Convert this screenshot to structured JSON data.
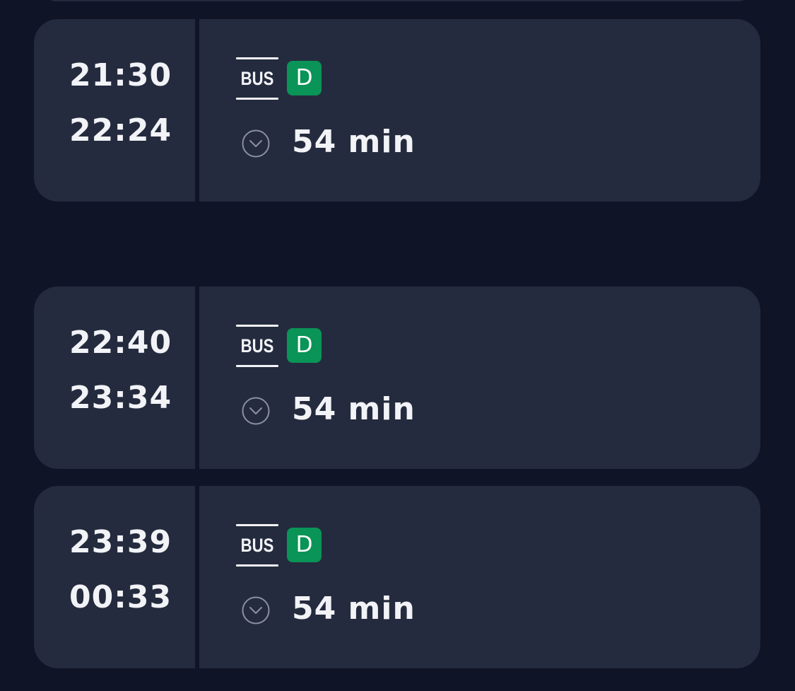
{
  "trips": [
    {
      "departure": "21:30",
      "arrival": "22:24",
      "mode": "BUS",
      "line": "D",
      "duration": "54 min"
    },
    {
      "departure": "22:40",
      "arrival": "23:34",
      "mode": "BUS",
      "line": "D",
      "duration": "54 min"
    },
    {
      "departure": "23:39",
      "arrival": "00:33",
      "mode": "BUS",
      "line": "D",
      "duration": "54 min"
    }
  ],
  "colors": {
    "background": "#0f1526",
    "card": "#252b3e",
    "line_badge": "#0a9457",
    "text": "#f2f3f7"
  },
  "icons": {
    "mode": "bus-icon",
    "expand": "chevron-down-circle-icon"
  }
}
